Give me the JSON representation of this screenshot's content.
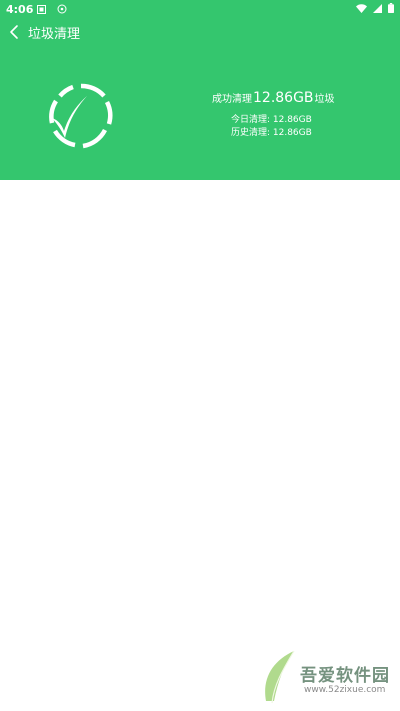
{
  "status_bar": {
    "time": "4:06",
    "left_icons": [
      "notification-box-icon",
      "notification-circle-icon"
    ],
    "right_icons": [
      "wifi-icon",
      "signal-icon",
      "battery-icon"
    ]
  },
  "app_bar": {
    "title": "垃圾清理",
    "back_icon": "chevron-left-icon"
  },
  "result": {
    "prefix": "成功清理",
    "size": "12.86GB",
    "suffix": "垃圾",
    "today_label": "今日清理: 12.86GB",
    "history_label": "历史清理: 12.86GB"
  },
  "watermark": {
    "title": "吾爱软件园",
    "url": "www.52zixue.com"
  },
  "colors": {
    "header_green": "#34c66e",
    "text_on_green": "#ffffff"
  }
}
